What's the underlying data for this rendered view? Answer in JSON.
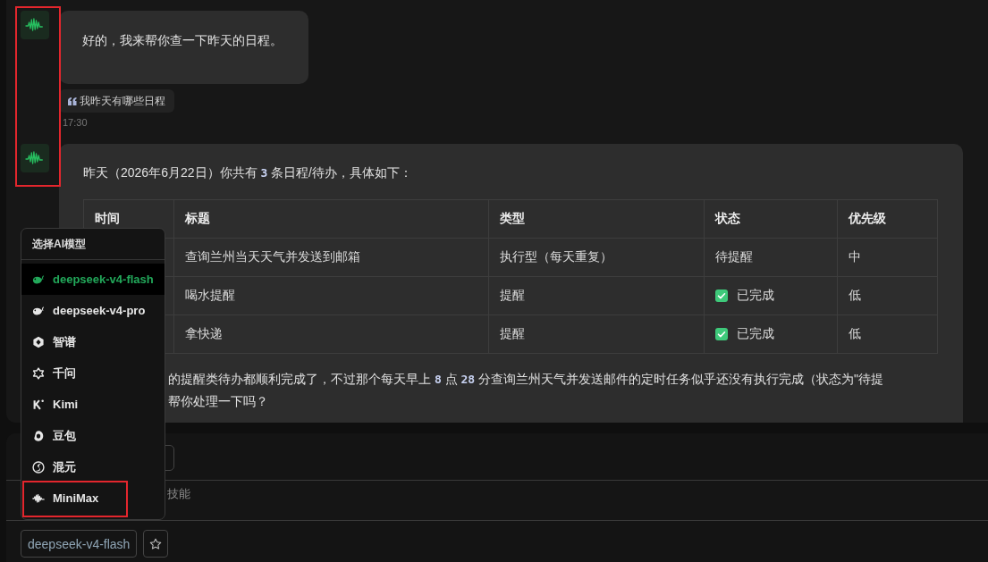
{
  "conversation": {
    "avatars_highlighted": true,
    "messages": [
      {
        "kind": "reply",
        "text": "好的，我来帮你查一下昨天的日程。",
        "quote": "我昨天有哪些日程",
        "time": "17:30"
      },
      {
        "kind": "table_reply",
        "intro": [
          {
            "text": "昨天（2026年6月22日）你共有 "
          },
          {
            "text": "3",
            "kind": "code"
          },
          {
            "text": " 条日程/待办，具体如下："
          }
        ],
        "table": {
          "columns": [
            "时间",
            "标题",
            "类型",
            "状态",
            "优先级"
          ],
          "rows": [
            {
              "title": "查询兰州当天天气并发送到邮箱",
              "type": "执行型（每天重复）",
              "status": {
                "text": "待提醒",
                "done": false
              },
              "priority": "中"
            },
            {
              "title": "喝水提醒",
              "type": "提醒",
              "status": {
                "text": "已完成",
                "done": true
              },
              "priority": "低"
            },
            {
              "title": "拿快递",
              "type": "提醒",
              "status": {
                "text": "已完成",
                "done": true
              },
              "priority": "低"
            }
          ]
        },
        "followup_lines": [
          [
            {
              "text": "的提醒类待办都顺利完成了，不过那个每天早上 "
            },
            {
              "text": "8",
              "kind": "code"
            },
            {
              "text": " 点 "
            },
            {
              "text": "28",
              "kind": "code"
            },
            {
              "text": " 分查询兰州天气并发送邮件的定时任务似乎还没有执行完成（状态为\"待提"
            }
          ],
          [
            {
              "text": "帮你处理一下吗？"
            }
          ]
        ]
      }
    ]
  },
  "model_menu": {
    "title": "选择AI模型",
    "items": [
      {
        "label": "deepseek-v4-flash",
        "selected": true,
        "highlighted": false
      },
      {
        "label": "deepseek-v4-pro",
        "selected": false,
        "highlighted": false
      },
      {
        "label": "智谱",
        "selected": false,
        "highlighted": false
      },
      {
        "label": "千问",
        "selected": false,
        "highlighted": false
      },
      {
        "label": "Kimi",
        "selected": false,
        "highlighted": false
      },
      {
        "label": "豆包",
        "selected": false,
        "highlighted": false
      },
      {
        "label": "混元",
        "selected": false,
        "highlighted": false
      },
      {
        "label": "MiniMax",
        "selected": false,
        "highlighted": true
      }
    ]
  },
  "composer": {
    "placeholder": "技能",
    "model_button": "deepseek-v4-flash"
  }
}
